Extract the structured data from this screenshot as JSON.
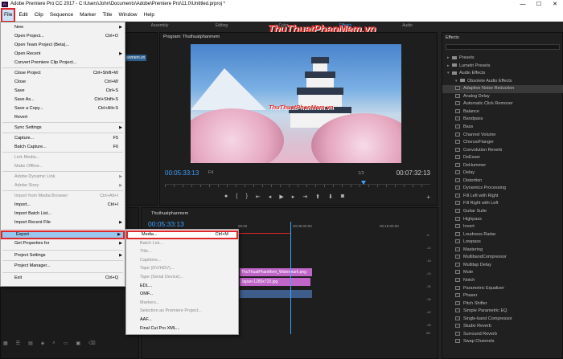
{
  "window": {
    "title": "Adobe Premiere Pro CC 2017 - C:\\Users\\John\\Documents\\Adobe\\Premiere Pro\\11.0\\Untitled.prproj *",
    "app_icon": "Pr",
    "minimize": "—",
    "maximize": "☐",
    "close": "✕"
  },
  "menubar": [
    "File",
    "Edit",
    "Clip",
    "Sequence",
    "Marker",
    "Title",
    "Window",
    "Help"
  ],
  "workspace_tabs": [
    "Assembly",
    "Editing",
    "Color",
    "Effects",
    "Audio"
  ],
  "watermark": "ThuThuatPhanMem.vn",
  "file_menu": [
    {
      "label": "New",
      "shortcut": "",
      "submenu": true,
      "disabled": false
    },
    {
      "label": "Open Project...",
      "shortcut": "Ctrl+O",
      "submenu": false,
      "disabled": false
    },
    {
      "label": "Open Team Project (Beta)...",
      "shortcut": "",
      "submenu": false,
      "disabled": false
    },
    {
      "label": "Open Recent",
      "shortcut": "",
      "submenu": true,
      "disabled": false
    },
    {
      "label": "Convert Premiere Clip Project...",
      "shortcut": "",
      "submenu": false,
      "disabled": false
    },
    {
      "label": "Close Project",
      "shortcut": "Ctrl+Shift+W",
      "submenu": false,
      "disabled": false
    },
    {
      "label": "Close",
      "shortcut": "Ctrl+W",
      "submenu": false,
      "disabled": false
    },
    {
      "label": "Save",
      "shortcut": "Ctrl+S",
      "submenu": false,
      "disabled": false
    },
    {
      "label": "Save As...",
      "shortcut": "Ctrl+Shift+S",
      "submenu": false,
      "disabled": false
    },
    {
      "label": "Save a Copy...",
      "shortcut": "Ctrl+Alt+S",
      "submenu": false,
      "disabled": false
    },
    {
      "label": "Revert",
      "shortcut": "",
      "submenu": false,
      "disabled": false
    },
    {
      "label": "Sync Settings",
      "shortcut": "",
      "submenu": true,
      "disabled": false
    },
    {
      "label": "Capture...",
      "shortcut": "F5",
      "submenu": false,
      "disabled": false
    },
    {
      "label": "Batch Capture...",
      "shortcut": "F6",
      "submenu": false,
      "disabled": false
    },
    {
      "label": "Link Media...",
      "shortcut": "",
      "submenu": false,
      "disabled": true
    },
    {
      "label": "Make Offline...",
      "shortcut": "",
      "submenu": false,
      "disabled": true
    },
    {
      "label": "Adobe Dynamic Link",
      "shortcut": "",
      "submenu": true,
      "disabled": true
    },
    {
      "label": "Adobe Story",
      "shortcut": "",
      "submenu": true,
      "disabled": true
    },
    {
      "label": "Import from Media Browser",
      "shortcut": "Ctrl+Alt+I",
      "submenu": false,
      "disabled": true
    },
    {
      "label": "Import...",
      "shortcut": "Ctrl+I",
      "submenu": false,
      "disabled": false
    },
    {
      "label": "Import Batch List...",
      "shortcut": "",
      "submenu": false,
      "disabled": false
    },
    {
      "label": "Import Recent File",
      "shortcut": "",
      "submenu": true,
      "disabled": false
    },
    {
      "label": "Export",
      "shortcut": "",
      "submenu": true,
      "disabled": false
    },
    {
      "label": "Get Properties for",
      "shortcut": "",
      "submenu": true,
      "disabled": false
    },
    {
      "label": "Project Settings",
      "shortcut": "",
      "submenu": true,
      "disabled": false
    },
    {
      "label": "Project Manager...",
      "shortcut": "",
      "submenu": false,
      "disabled": false
    },
    {
      "label": "Exit",
      "shortcut": "Ctrl+Q",
      "submenu": false,
      "disabled": false
    }
  ],
  "export_menu": [
    {
      "label": "Media...",
      "shortcut": "Ctrl+M",
      "disabled": false
    },
    {
      "label": "Batch List...",
      "shortcut": "",
      "disabled": true
    },
    {
      "label": "Title...",
      "shortcut": "",
      "disabled": true
    },
    {
      "label": "Captions...",
      "shortcut": "",
      "disabled": true
    },
    {
      "label": "Tape (DV/HDV)...",
      "shortcut": "",
      "disabled": true
    },
    {
      "label": "Tape (Serial Device)...",
      "shortcut": "",
      "disabled": true
    },
    {
      "label": "EDL...",
      "shortcut": "",
      "disabled": false
    },
    {
      "label": "OMF...",
      "shortcut": "",
      "disabled": false
    },
    {
      "label": "Markers...",
      "shortcut": "",
      "disabled": true
    },
    {
      "label": "Selection as Premiere Project...",
      "shortcut": "",
      "disabled": true
    },
    {
      "label": "AAF...",
      "shortcut": "",
      "disabled": false
    },
    {
      "label": "Final Cut Pro XML...",
      "shortcut": "",
      "disabled": false
    }
  ],
  "program": {
    "title": "Program: Thuthuatphanmem",
    "timecode": "00:05:33:13",
    "fit": "Fit",
    "fraction": "1/2",
    "duration": "00:07:32:13",
    "video_watermark": "ThuThuatPhanMem.vn"
  },
  "source": {
    "clip_label": "anmem.vn"
  },
  "timeline": {
    "title": "Thuthuatphanmem",
    "timecode": "00:05:33:13",
    "ruler": [
      "00:00",
      "00:05:00:00",
      "00:15:00:00"
    ],
    "clips": [
      "ThuThuatPhanMem_Watermark.png",
      "Japan-1280x720.jpg",
      ""
    ]
  },
  "audio_meter": [
    "-6",
    "-12",
    "-18",
    "-24",
    "-30",
    "-36",
    "-42",
    "-48",
    "-54",
    "dB"
  ],
  "effects": {
    "title": "Effects",
    "items": [
      {
        "label": "Presets",
        "type": "folder",
        "indent": 1
      },
      {
        "label": "Lumetri Presets",
        "type": "folder",
        "indent": 1
      },
      {
        "label": "Audio Effects",
        "type": "folder",
        "indent": 1
      },
      {
        "label": "Obsolete Audio Effects",
        "type": "folder",
        "indent": 2
      },
      {
        "label": "Adaptive Noise Reduction",
        "type": "effect",
        "indent": 2,
        "selected": true
      },
      {
        "label": "Analog Delay",
        "type": "effect",
        "indent": 2
      },
      {
        "label": "Automatic Click Remover",
        "type": "effect",
        "indent": 2
      },
      {
        "label": "Balance",
        "type": "effect",
        "indent": 2
      },
      {
        "label": "Bandpass",
        "type": "effect",
        "indent": 2
      },
      {
        "label": "Bass",
        "type": "effect",
        "indent": 2
      },
      {
        "label": "Channel Volume",
        "type": "effect",
        "indent": 2
      },
      {
        "label": "Chorus/Flanger",
        "type": "effect",
        "indent": 2
      },
      {
        "label": "Convolution Reverb",
        "type": "effect",
        "indent": 2
      },
      {
        "label": "DeEsser",
        "type": "effect",
        "indent": 2
      },
      {
        "label": "DeHummer",
        "type": "effect",
        "indent": 2
      },
      {
        "label": "Delay",
        "type": "effect",
        "indent": 2
      },
      {
        "label": "Distortion",
        "type": "effect",
        "indent": 2
      },
      {
        "label": "Dynamics Processing",
        "type": "effect",
        "indent": 2
      },
      {
        "label": "Fill Left with Right",
        "type": "effect",
        "indent": 2
      },
      {
        "label": "Fill Right with Left",
        "type": "effect",
        "indent": 2
      },
      {
        "label": "Guitar Suite",
        "type": "effect",
        "indent": 2
      },
      {
        "label": "Highpass",
        "type": "effect",
        "indent": 2
      },
      {
        "label": "Invert",
        "type": "effect",
        "indent": 2
      },
      {
        "label": "Loudness Radar",
        "type": "effect",
        "indent": 2
      },
      {
        "label": "Lowpass",
        "type": "effect",
        "indent": 2
      },
      {
        "label": "Mastering",
        "type": "effect",
        "indent": 2
      },
      {
        "label": "MultibandCompressor",
        "type": "effect",
        "indent": 2
      },
      {
        "label": "Multitap Delay",
        "type": "effect",
        "indent": 2
      },
      {
        "label": "Mute",
        "type": "effect",
        "indent": 2
      },
      {
        "label": "Notch",
        "type": "effect",
        "indent": 2
      },
      {
        "label": "Parametric Equalizer",
        "type": "effect",
        "indent": 2
      },
      {
        "label": "Phaser",
        "type": "effect",
        "indent": 2
      },
      {
        "label": "Pitch Shifter",
        "type": "effect",
        "indent": 2
      },
      {
        "label": "Simple Parametric EQ",
        "type": "effect",
        "indent": 2
      },
      {
        "label": "Single-band Compressor",
        "type": "effect",
        "indent": 2
      },
      {
        "label": "Studio Reverb",
        "type": "effect",
        "indent": 2
      },
      {
        "label": "Surround Reverb",
        "type": "effect",
        "indent": 2
      },
      {
        "label": "Swap Channels",
        "type": "effect",
        "indent": 2
      }
    ]
  },
  "colors": {
    "accent_blue": "#3ea3ff",
    "highlight_red": "#e0262a",
    "clip_pink": "#c066c8",
    "panel_bg": "#1e1e1e"
  }
}
